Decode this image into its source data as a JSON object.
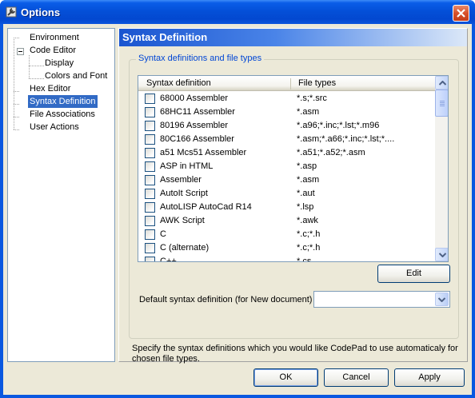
{
  "window": {
    "title": "Options",
    "app_icon": "options-wrench-icon",
    "close_icon": "close-icon"
  },
  "tree": {
    "items": [
      {
        "label": "Environment",
        "selected": false
      },
      {
        "label": "Code Editor",
        "selected": false,
        "expanded": true
      },
      {
        "label": "Display",
        "selected": false
      },
      {
        "label": "Colors and Font",
        "selected": false
      },
      {
        "label": "Hex Editor",
        "selected": false
      },
      {
        "label": "Syntax Definition",
        "selected": true
      },
      {
        "label": "File Associations",
        "selected": false
      },
      {
        "label": "User Actions",
        "selected": false
      }
    ]
  },
  "panel": {
    "title": "Syntax Definition",
    "group_title": "Syntax definitions and file types",
    "columns": [
      "Syntax definition",
      "File types"
    ],
    "rows": [
      {
        "name": "68000 Assembler",
        "types": "*.s;*.src",
        "checked": false
      },
      {
        "name": "68HC11 Assembler",
        "types": "*.asm",
        "checked": false
      },
      {
        "name": "80196 Assembler",
        "types": "*.a96;*.inc;*.lst;*.m96",
        "checked": false
      },
      {
        "name": "80C166 Assembler",
        "types": "*.asm;*.a66;*.inc;*.lst;*....",
        "checked": false
      },
      {
        "name": "a51 Mcs51 Assembler",
        "types": "*.a51;*.a52;*.asm",
        "checked": false
      },
      {
        "name": "ASP in HTML",
        "types": "*.asp",
        "checked": false
      },
      {
        "name": "Assembler",
        "types": "*.asm",
        "checked": false
      },
      {
        "name": "AutoIt Script",
        "types": "*.aut",
        "checked": false
      },
      {
        "name": "AutoLISP AutoCad R14",
        "types": "*.lsp",
        "checked": false
      },
      {
        "name": "AWK Script",
        "types": "*.awk",
        "checked": false
      },
      {
        "name": "C",
        "types": "*.c;*.h",
        "checked": false
      },
      {
        "name": "C (alternate)",
        "types": "*.c;*.h",
        "checked": false
      },
      {
        "name": "C++",
        "types": "*.cs",
        "checked": false
      }
    ],
    "edit_label": "Edit",
    "default_label": "Default syntax definition (for New document)",
    "default_value": "",
    "description": "Specify the syntax definitions which you would like CodePad to use automaticaly for chosen file types."
  },
  "buttons": {
    "ok": "OK",
    "cancel": "Cancel",
    "apply": "Apply"
  },
  "colors": {
    "title_bar": "#0450d8",
    "selection": "#316ac5",
    "group_title": "#0046d5",
    "dialog_bg": "#ece9d8"
  }
}
